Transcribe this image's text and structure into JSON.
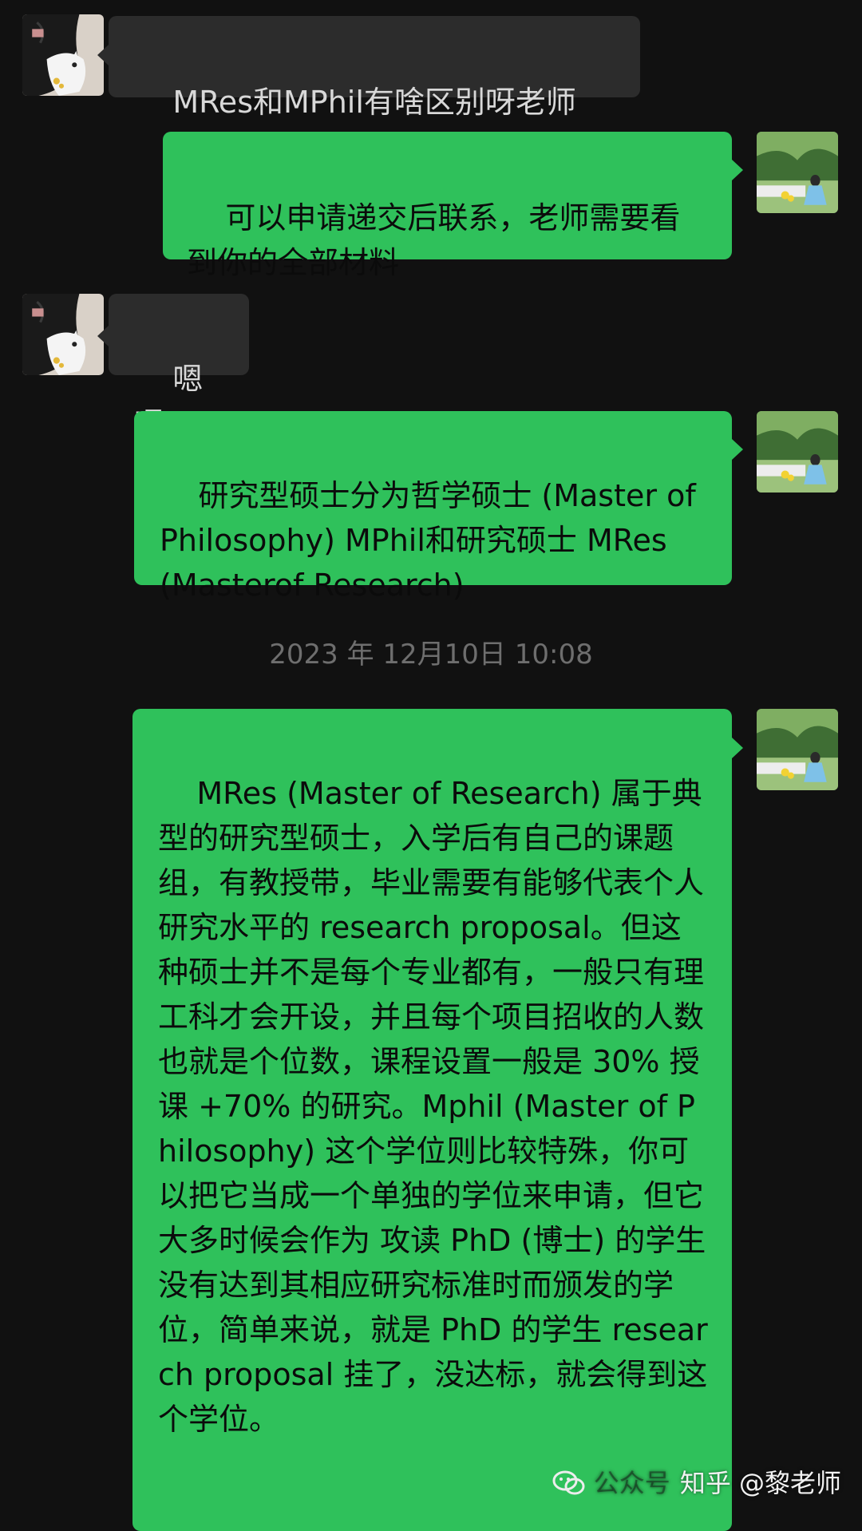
{
  "messages": [
    {
      "sender": "student",
      "text": "MRes和MPhil有啥区别呀老师"
    },
    {
      "sender": "teacher",
      "text": "可以申请递交后联系，老师需要看到你的全部材料"
    },
    {
      "sender": "student",
      "text": "嗯嗯"
    },
    {
      "sender": "teacher",
      "text": "研究型硕士分为哲学硕士 (Master of Philosophy) MPhil和研究硕士 MRes (Masterof Research)"
    },
    {
      "sender": "teacher",
      "text": "MRes (Master of Research) 属于典型的研究型硕士，入学后有自己的课题组，有教授带，毕业需要有能够代表个人研究水平的 research proposal。但这种硕士并不是每个专业都有，一般只有理工科才会开设，并且每个项目招收的人数也就是个位数，课程设置一般是 30% 授课 +70% 的研究。Mphil (Master of Philosophy) 这个学位则比较特殊，你可以把它当成一个单独的学位来申请，但它大多时候会作为 攻读 PhD (博士) 的学生没有达到其相应研究标准时而颁发的学位，简单来说，就是 PhD 的学生 research proposal 挂了，没达标，就会得到这个学位。"
    }
  ],
  "timestamp": "2023 年 12月10日 10:08",
  "watermark": {
    "source": "公众号",
    "text": "知乎 @黎老师",
    "icon": "wechat-official-account-icon"
  },
  "colors": {
    "background": "#111111",
    "incoming_bubble": "#2c2c2c",
    "outgoing_bubble": "#2fc15b",
    "timestamp": "#6e6e6e"
  }
}
